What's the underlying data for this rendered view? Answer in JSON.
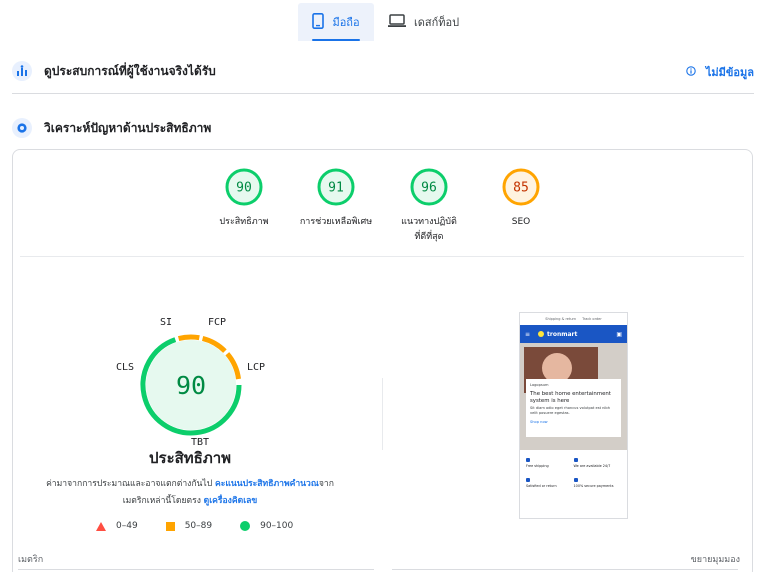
{
  "tabs": {
    "mobile": "มือถือ",
    "desktop": "เดสก์ท็อป"
  },
  "cwv": {
    "title": "ดูประสบการณ์ที่ผู้ใช้งานจริงได้รับ",
    "no_data": "ไม่มีข้อมูล"
  },
  "diagnose": {
    "title": "วิเคราะห์ปัญหาด้านประสิทธิภาพ"
  },
  "scores": [
    {
      "value": "90",
      "label": "ประสิทธิภาพ",
      "status": "pass"
    },
    {
      "value": "91",
      "label": "การช่วยเหลือพิเศษ",
      "status": "pass"
    },
    {
      "value": "96",
      "label": "แนวทางปฏิบัติที่ดีที่สุด",
      "status": "pass"
    },
    {
      "value": "85",
      "label": "SEO",
      "status": "average"
    }
  ],
  "performance": {
    "score": "90",
    "title": "ประสิทธิภาพ",
    "metrics": {
      "si": "SI",
      "fcp": "FCP",
      "lcp": "LCP",
      "cls": "CLS",
      "tbt": "TBT"
    },
    "desc_before": "ค่ามาจากการประมาณและอาจแตกต่างกันไป ",
    "desc_link1": "คะแนนประสิทธิภาพคำนวณ",
    "desc_mid": "จากเมตริกเหล่านี้โดยตรง ",
    "desc_link2": "ดูเครื่องคิดเลข"
  },
  "legend": {
    "fail": "0–49",
    "average": "50–89",
    "pass": "90–100"
  },
  "footer": {
    "metrics": "เมตริก",
    "expand": "ขยายมุมมอง"
  },
  "preview": {
    "topbar_left": "Shipping & return",
    "topbar_right": "Track order",
    "brand": "tronmart",
    "modal_brand": "Logopsum",
    "modal_title": "The best home entertainment system is here",
    "modal_text": "Sit diam odio eget rhoncus volutpat est nibh velit posuere egestas.",
    "modal_link": "Shop now",
    "features": [
      "Free shipping",
      "We are available 24/7",
      "Satisfied or return",
      "100% secure payments"
    ]
  },
  "colors": {
    "pass": "#0cce6b",
    "average": "#ffa400",
    "fail": "#ff4e42",
    "accent": "#1a73e8"
  }
}
